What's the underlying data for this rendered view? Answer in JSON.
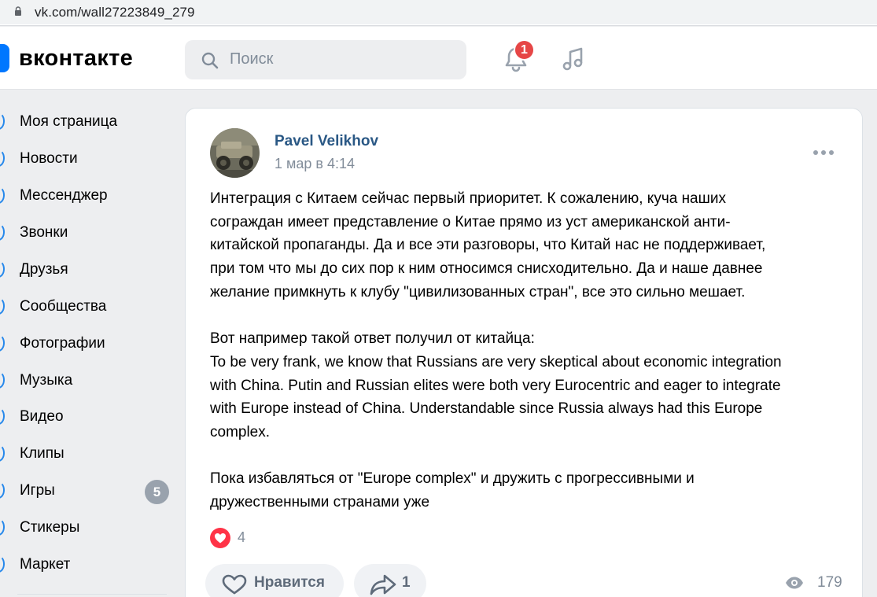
{
  "browser": {
    "url": "vk.com/wall27223849_279"
  },
  "header": {
    "logo_text": "вконтакте",
    "search_placeholder": "Поиск",
    "notifications_count": "1"
  },
  "sidebar": {
    "items": [
      {
        "label": "Моя страница",
        "icon": "user-icon"
      },
      {
        "label": "Новости",
        "icon": "news-icon"
      },
      {
        "label": "Мессенджер",
        "icon": "messenger-icon"
      },
      {
        "label": "Звонки",
        "icon": "phone-icon"
      },
      {
        "label": "Друзья",
        "icon": "friends-icon"
      },
      {
        "label": "Сообщества",
        "icon": "communities-icon"
      },
      {
        "label": "Фотографии",
        "icon": "photos-icon"
      },
      {
        "label": "Музыка",
        "icon": "music-icon"
      },
      {
        "label": "Видео",
        "icon": "video-icon"
      },
      {
        "label": "Клипы",
        "icon": "clips-icon"
      },
      {
        "label": "Игры",
        "icon": "games-icon",
        "count": "5"
      },
      {
        "label": "Стикеры",
        "icon": "stickers-icon"
      },
      {
        "label": "Маркет",
        "icon": "market-icon"
      }
    ]
  },
  "post": {
    "author": "Pavel Velikhov",
    "date": "1 мар в 4:14",
    "text_lines": [
      "Интеграция с Китаем сейчас первый приоритет. К сожалению, куча наших",
      "сограждан имеет представление о Китае прямо из уст американской анти-",
      "китайской пропаганды. Да и все эти разговоры, что Китай нас не поддерживает,",
      "при том что мы до сих пор к ним относимся снисходительно. Да и наше давнее",
      "желание примкнуть к клубу \"цивилизованных стран\", все это сильно мешает.",
      "",
      "Вот например такой ответ получил от китайца:",
      "To be very frank, we know that Russians are very skeptical about economic integration",
      "with China. Putin and Russian elites were both very Eurocentric and eager to integrate",
      "with Europe instead of China. Understandable since Russia always had this Europe",
      "complex.",
      "",
      "Пока избавляться от \"Europe complex\" и дружить с прогрессивными и",
      "дружественными странами уже"
    ],
    "reactions_count": "4",
    "like_label": "Нравится",
    "share_count": "1",
    "views_count": "179"
  },
  "colors": {
    "accent": "#0077ff",
    "link": "#2a5885",
    "secondary_text": "#818c99",
    "badge_red": "#e64646",
    "heart_red": "#ff3347",
    "background": "#edeef0"
  }
}
